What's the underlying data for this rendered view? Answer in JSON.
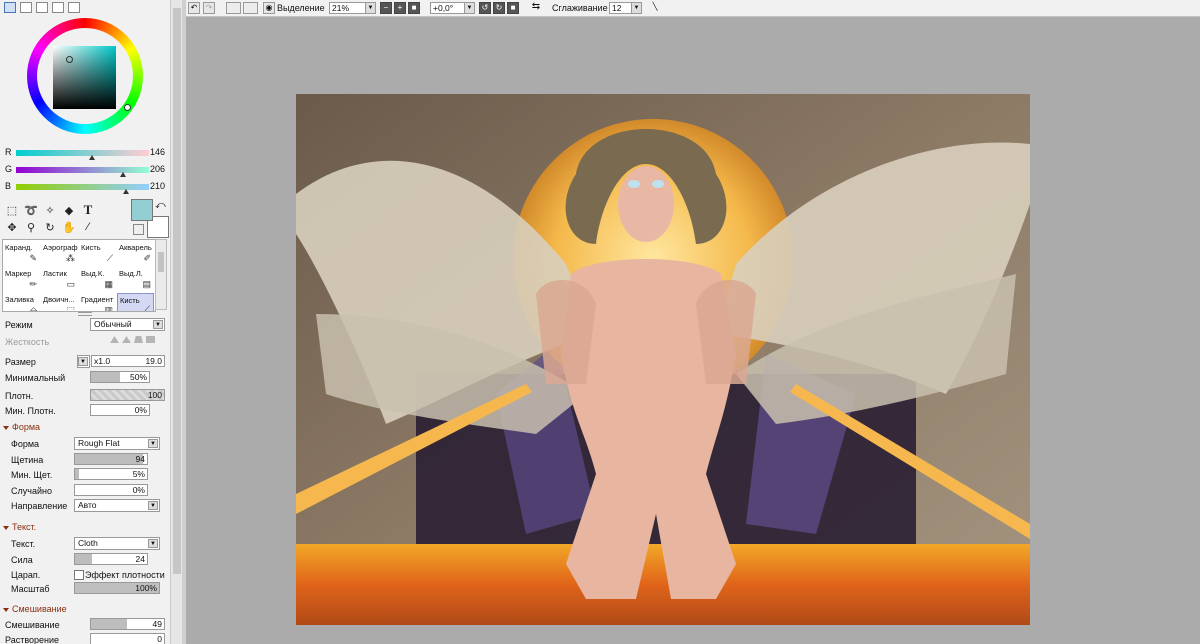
{
  "colors": {
    "primary": "#92ced2",
    "secondary": "#ffffff",
    "accent": "#8a3010"
  },
  "rgb": [
    {
      "label": "R",
      "value": "146",
      "frac": 0.573
    },
    {
      "label": "G",
      "value": "206",
      "frac": 0.808
    },
    {
      "label": "B",
      "value": "210",
      "frac": 0.824
    }
  ],
  "toolbar": {
    "selection_label": "Выделение",
    "zoom": "21%",
    "rotation": "+0,0°",
    "smoothing_label": "Сглаживание",
    "smoothing": "12"
  },
  "brushes": [
    {
      "label": "Каранд.",
      "icon": "pencil-icon"
    },
    {
      "label": "Аэрограф",
      "icon": "airbrush-icon"
    },
    {
      "label": "Кисть",
      "icon": "brush-icon"
    },
    {
      "label": "Акварель",
      "icon": "watercolor-icon"
    },
    {
      "label": "Маркер",
      "icon": "marker-icon"
    },
    {
      "label": "Ластик",
      "icon": "eraser-icon"
    },
    {
      "label": "Выд.К.",
      "icon": "select-pen-icon"
    },
    {
      "label": "Выд.Л.",
      "icon": "select-eraser-icon"
    },
    {
      "label": "Заливка",
      "icon": "bucket-icon"
    },
    {
      "label": "Двоичн...",
      "icon": "binary-icon"
    },
    {
      "label": "Градиент",
      "icon": "gradient-icon"
    },
    {
      "label": "Кисть",
      "icon": "brush-icon",
      "selected": true
    }
  ],
  "props": {
    "mode_label": "Режим",
    "mode_value": "Обычный",
    "hardness_label": "Жесткость",
    "size_label": "Размер",
    "size_mult": "x1.0",
    "size_value": "19.0",
    "min_size_label": "Минимальный",
    "min_size_value": "50%",
    "min_size_frac": 0.5,
    "density_label": "Плотн.",
    "density_value": "100",
    "density_frac": 1.0,
    "min_density_label": "Мин. Плотн.",
    "min_density_value": "0%",
    "min_density_frac": 0
  },
  "shape_section": {
    "title": "Форма",
    "shape_label": "Форма",
    "shape_value": "Rough Flat",
    "bristle_label": "Щетина",
    "bristle_value": "94",
    "bristle_frac": 0.94,
    "min_bristle_label": "Мин. Щет.",
    "min_bristle_value": "5%",
    "min_bristle_frac": 0.05,
    "random_label": "Случайно",
    "random_value": "0%",
    "random_frac": 0,
    "direction_label": "Направление",
    "direction_value": "Авто"
  },
  "texture_section": {
    "title": "Текст.",
    "texture_label": "Текст.",
    "texture_value": "Cloth",
    "strength_label": "Сила",
    "strength_value": "24",
    "strength_frac": 0.24,
    "scratch_label": "Царап.",
    "density_effect_label": "Эффект плотности",
    "scale_label": "Масштаб",
    "scale_value": "100%",
    "scale_frac": 1.0
  },
  "blend_section": {
    "title": "Смешивание",
    "blend_label": "Смешивание",
    "blend_value": "49",
    "blend_frac": 0.49,
    "dilution_label": "Растворение",
    "dilution_value": "0",
    "dilution_frac": 0
  }
}
